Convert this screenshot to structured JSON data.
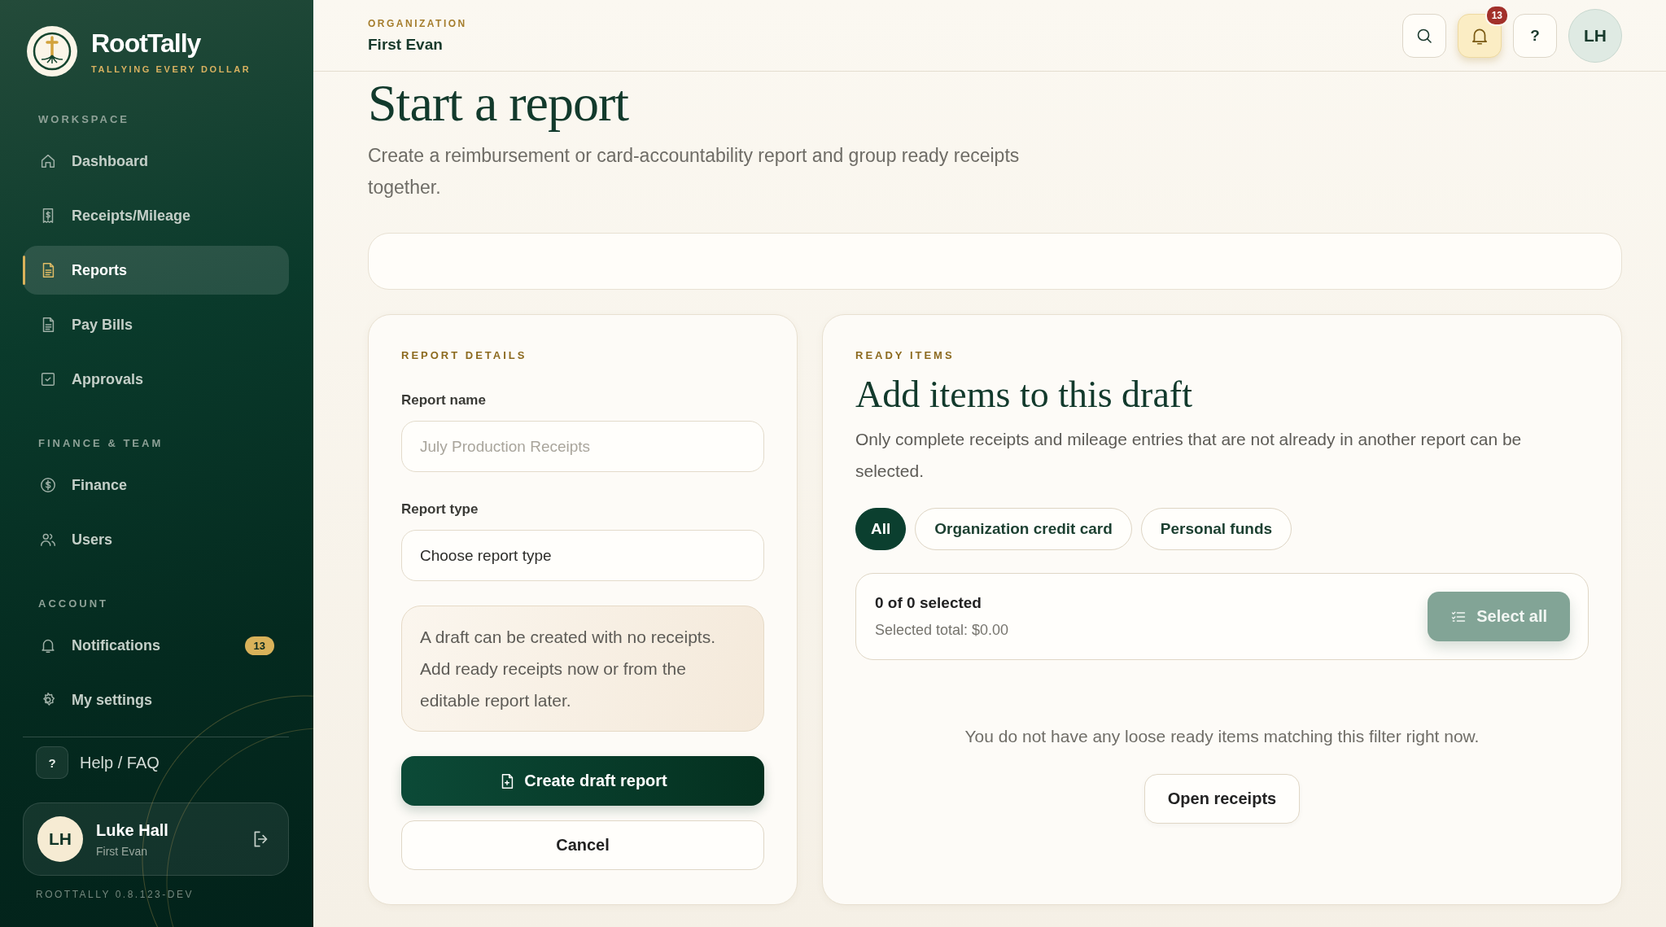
{
  "sidebar": {
    "brand": {
      "name": "RootTally",
      "tagline": "TALLYING EVERY DOLLAR"
    },
    "sections": [
      {
        "heading": "WORKSPACE",
        "items": [
          {
            "label": "Dashboard",
            "selected": false
          },
          {
            "label": "Receipts/Mileage",
            "selected": false
          },
          {
            "label": "Reports",
            "selected": true
          },
          {
            "label": "Pay Bills",
            "selected": false
          },
          {
            "label": "Approvals",
            "selected": false
          }
        ]
      },
      {
        "heading": "FINANCE & TEAM",
        "items": [
          {
            "label": "Finance",
            "selected": false
          },
          {
            "label": "Users",
            "selected": false
          }
        ]
      },
      {
        "heading": "ACCOUNT",
        "items": [
          {
            "label": "Notifications",
            "selected": false,
            "badge": "13"
          },
          {
            "label": "My settings",
            "selected": false
          }
        ]
      }
    ],
    "help": {
      "mark": "?",
      "label": "Help / FAQ"
    },
    "user": {
      "initials": "LH",
      "name": "Luke Hall",
      "organization": "First Evan"
    },
    "version": "ROOTTALLY 0.8.123-DEV"
  },
  "header": {
    "org_label": "ORGANIZATION",
    "org_name": "First Evan",
    "notification_count": "13",
    "bell_active": true,
    "help_mark": "?",
    "avatar_initials": "LH"
  },
  "page": {
    "title": "Start a report",
    "subtitle": "Create a reimbursement or card-accountability report and group ready receipts together."
  },
  "details": {
    "heading": "REPORT DETAILS",
    "fields": [
      {
        "label": "Report name",
        "placeholder": "July Production Receipts"
      },
      {
        "label": "Report type",
        "value": "Choose report type"
      }
    ],
    "note": "A draft can be created with no receipts. Add ready receipts now or from the editable report later.",
    "primary_button": "Create draft report",
    "cancel_button": "Cancel"
  },
  "ready": {
    "eyebrow": "READY ITEMS",
    "title": "Add items to this draft",
    "description": "Only complete receipts and mileage entries that are not already in another report can be selected.",
    "filters": [
      {
        "label": "All",
        "selected": true
      },
      {
        "label": "Organization credit card",
        "selected": false
      },
      {
        "label": "Personal funds",
        "selected": false
      }
    ],
    "selection": {
      "count": "0 of 0 selected",
      "total": "Selected total: $0.00",
      "button": "Select all",
      "disabled": true
    },
    "empty_message": "You do not have any loose ready items matching this filter right now.",
    "open_button": "Open receipts"
  }
}
